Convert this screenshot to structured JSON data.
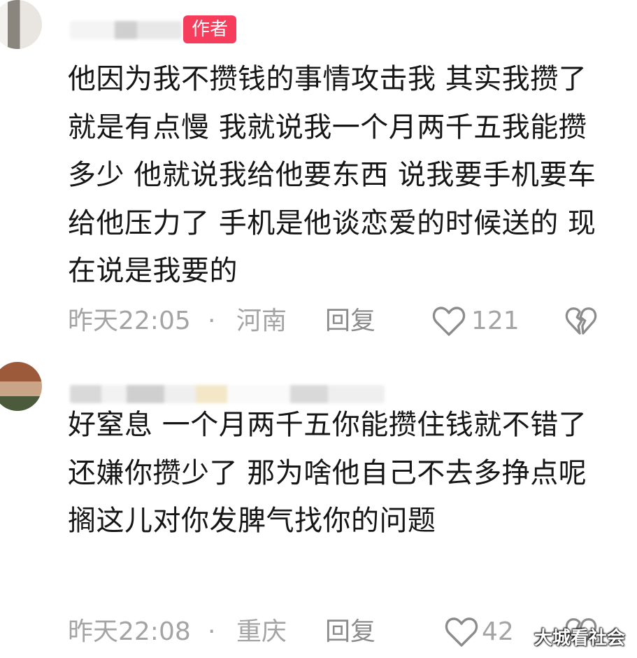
{
  "comments": [
    {
      "author_badge": "作者",
      "text": "他因为我不攒钱的事情攻击我 其实我攒了就是有点慢 我就说我一个月两千五我能攒多少 他就说我给他要东西 说我要手机要车给他压力了 手机是他谈恋爱的时候送的 现在说是我要的",
      "time": "昨天22:05",
      "separator": "·",
      "location": "河南",
      "reply_label": "回复",
      "like_count": "121",
      "like_icon": "heart-outline-icon",
      "dislike_icon": "broken-heart-icon"
    },
    {
      "text": "好窒息 一个月两千五你能攒住钱就不错了 还嫌你攒少了 那为啥他自己不去多挣点呢 搁这儿对你发脾气找你的问题",
      "time": "昨天22:08",
      "separator": "·",
      "location": "重庆",
      "reply_label": "回复",
      "like_count": "42",
      "like_icon": "heart-outline-icon",
      "dislike_icon": "broken-heart-icon"
    }
  ],
  "watermark": "大城看社会",
  "colors": {
    "badge_bg": "#f73d5c",
    "meta_text": "#a4a4a4",
    "body_text": "#161616"
  }
}
